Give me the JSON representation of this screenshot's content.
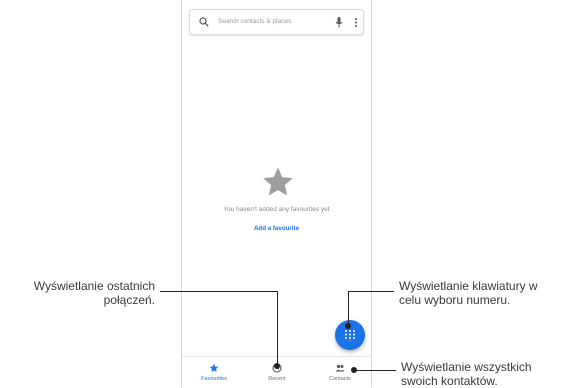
{
  "search": {
    "placeholder": "Search contacts & places"
  },
  "empty_state": {
    "message": "You haven't added any favourites yet",
    "link": "Add a favourite"
  },
  "nav": [
    {
      "label": "Favourites",
      "icon": "star-icon",
      "active": true
    },
    {
      "label": "Recent",
      "icon": "clock-icon",
      "active": false
    },
    {
      "label": "Contacts",
      "icon": "people-icon",
      "active": false
    }
  ],
  "annotations": {
    "recent": [
      "Wyświetlanie ostatnich",
      "połączeń."
    ],
    "keypad": [
      "Wyświetlanie klawiatury w",
      "celu wyboru numeru."
    ],
    "contacts": [
      "Wyświetlanie wszystkich",
      "swoich kontaktów."
    ]
  },
  "colors": {
    "accent": "#1a73e8",
    "star": "#9e9e9e"
  }
}
